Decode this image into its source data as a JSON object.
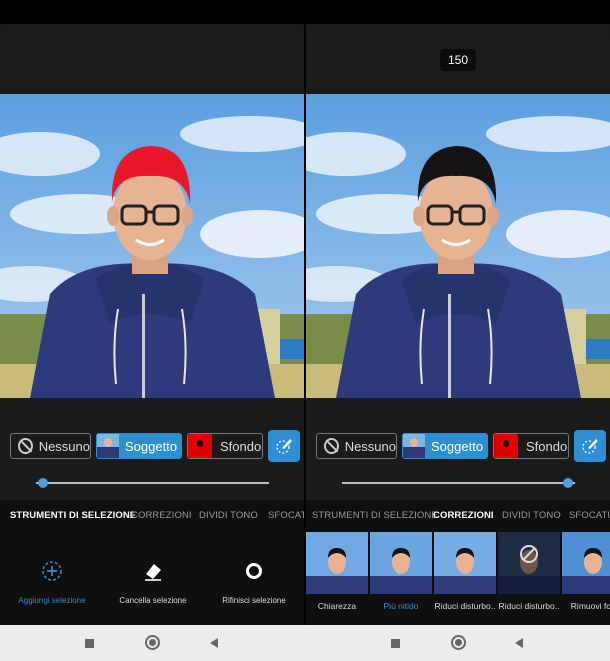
{
  "left": {
    "chips": {
      "none": "Nessuno",
      "subject": "Soggetto",
      "background": "Sfondo"
    },
    "slider": {
      "value_fraction": 0.03
    },
    "tabs": [
      "STRUMENTI DI SELEZIONE",
      "CORREZIONI",
      "DIVIDI TONO",
      "SFOCATU"
    ],
    "active_tab": "STRUMENTI DI SELEZIONE",
    "tools": [
      {
        "label": "Aggiungi selezione",
        "icon": "add-selection-icon"
      },
      {
        "label": "Cancella selezione",
        "icon": "eraser-icon"
      },
      {
        "label": "Rifinisci selezione",
        "icon": "refine-circle-icon"
      }
    ],
    "hair_color": "#e8182a"
  },
  "right": {
    "value_badge": "150",
    "chips": {
      "none": "Nessuno",
      "subject": "Soggetto",
      "background": "Sfondo"
    },
    "slider": {
      "value_fraction": 0.97
    },
    "tabs": [
      "STRUMENTI DI SELEZIONE",
      "CORREZIONI",
      "DIVIDI TONO",
      "SFOCATU"
    ],
    "active_tab": "CORREZIONI",
    "effects": [
      {
        "label": "Chiarezza"
      },
      {
        "label": "Più nitido",
        "selected": true
      },
      {
        "label": "Riduci disturbo.."
      },
      {
        "label": "Riduci disturbo.."
      },
      {
        "label": "Rimuovi fos"
      }
    ],
    "hair_color": "#141414"
  },
  "colors": {
    "accent": "#2c8fd0",
    "panel": "#1b1b1b",
    "toolbar": "#0f0f0f"
  },
  "navbar": {
    "icons": [
      "recents-square-icon",
      "home-circle-icon",
      "back-triangle-icon"
    ]
  }
}
